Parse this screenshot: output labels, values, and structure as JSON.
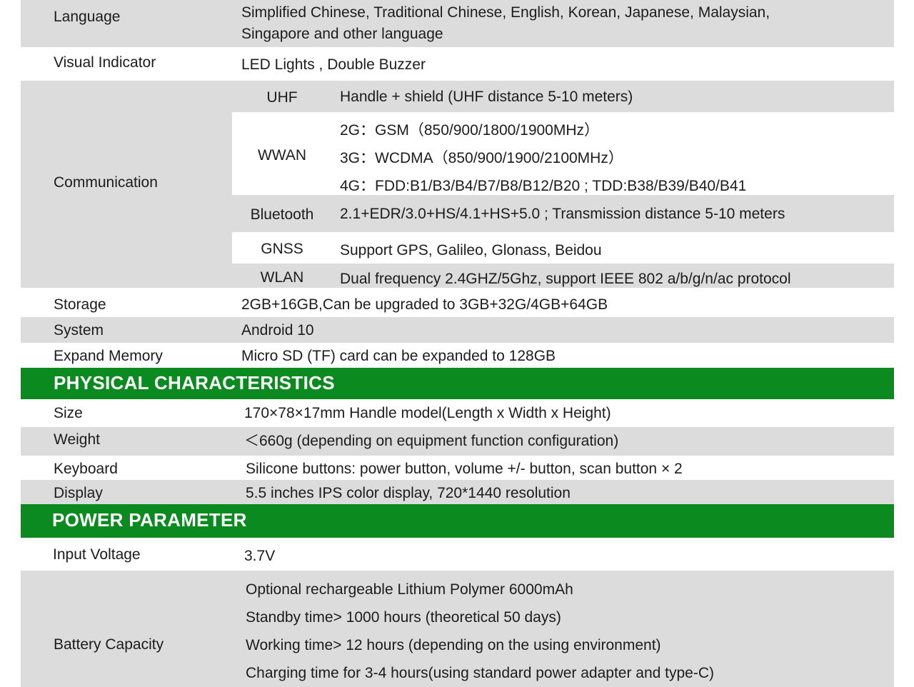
{
  "spec_rows": {
    "language": {
      "label": "Language",
      "value_line1": "Simplified Chinese, Traditional Chinese, English, Korean, Japanese, Malaysian,",
      "value_line2": "Singapore and other language"
    },
    "visual_indicator": {
      "label": "Visual  Indicator",
      "value": "LED Lights , Double Buzzer"
    },
    "communication": {
      "label": "Communication",
      "uhf": {
        "label": "UHF",
        "value": "Handle + shield (UHF distance 5-10 meters)"
      },
      "wwan": {
        "label": "WWAN",
        "lines": [
          "2G：GSM（850/900/1800/1900MHz）",
          "3G：WCDMA（850/900/1900/2100MHz）",
          "4G：FDD:B1/B3/B4/B7/B8/B12/B20 ; TDD:B38/B39/B40/B41"
        ]
      },
      "bluetooth": {
        "label": "Bluetooth",
        "value": "2.1+EDR/3.0+HS/4.1+HS+5.0  ; Transmission distance 5-10 meters"
      },
      "gnss": {
        "label": "GNSS",
        "value": "Support GPS, Galileo, Glonass, Beidou"
      },
      "wlan": {
        "label": "WLAN",
        "value": "Dual frequency 2.4GHZ/5Ghz, support IEEE 802 a/b/g/n/ac protocol"
      }
    },
    "storage": {
      "label": "Storage",
      "value": "2GB+16GB,Can be upgraded to 3GB+32G/4GB+64GB"
    },
    "system": {
      "label": "System",
      "value": "Android 10"
    },
    "expand_memory": {
      "label": "Expand Memory",
      "value": "Micro SD (TF) card can be expanded to 128GB"
    }
  },
  "physical": {
    "heading": "PHYSICAL CHARACTERISTICS",
    "size": {
      "label": "Size",
      "value": "170×78×17mm Handle model(Length x Width x Height)"
    },
    "weight": {
      "label": "Weight",
      "value": "＜660g (depending on equipment function configuration)"
    },
    "keyboard": {
      "label": "Keyboard",
      "value": "Silicone buttons: power button, volume +/- button, scan button × 2"
    },
    "display": {
      "label": "Display",
      "value": "5.5 inches IPS color display, 720*1440 resolution"
    }
  },
  "power": {
    "heading": "POWER PARAMETER",
    "input_voltage": {
      "label": "Input Voltage",
      "value": "3.7V"
    },
    "battery": {
      "label": "Battery Capacity",
      "lines": [
        "Optional rechargeable Lithium Polymer 6000mAh",
        "Standby time> 1000 hours (theoretical 50 days)",
        "Working time> 12 hours (depending on the using environment)",
        "Charging time for 3-4 hours(using standard power adapter and type-C)"
      ]
    }
  },
  "colors": {
    "section_header_bg": "#0b8a1f",
    "row_grey": "#dcdcdc",
    "row_white": "#ffffff",
    "text": "#1c1c1c"
  }
}
